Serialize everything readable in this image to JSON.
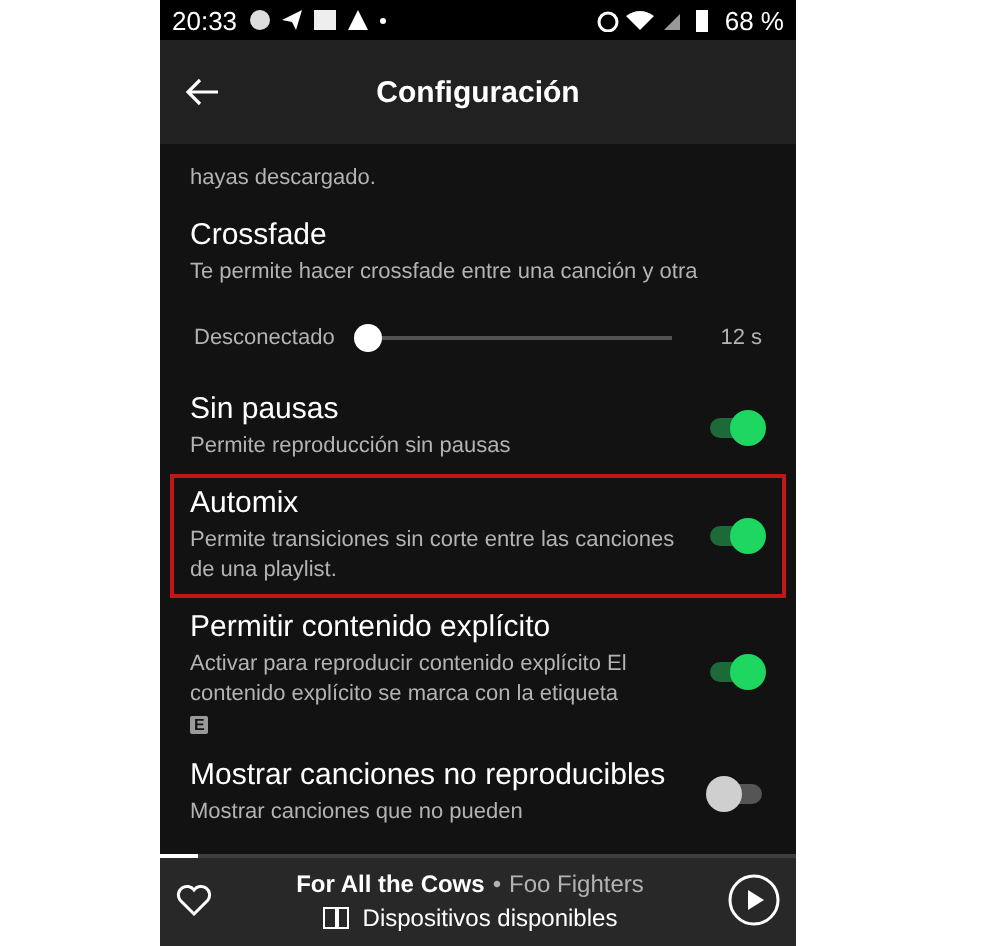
{
  "status_bar": {
    "time": "20:33",
    "battery": "68 %"
  },
  "header": {
    "title": "Configuración"
  },
  "settings": [
    {
      "kind": "text",
      "description": "hayas descargado."
    },
    {
      "kind": "text",
      "title": "Crossfade",
      "description": "Te permite hacer crossfade entre una canción y otra"
    },
    {
      "kind": "slider",
      "min_label": "Desconectado",
      "max_label": "12 s",
      "level": 0
    },
    {
      "kind": "toggle",
      "title": "Sin pausas",
      "description": "Permite reproducción sin pausas",
      "on": true,
      "highlighted": false
    },
    {
      "kind": "toggle",
      "title": "Automix",
      "description": "Permite transiciones sin corte entre las canciones de una playlist.",
      "on": true,
      "highlighted": true
    },
    {
      "kind": "toggle",
      "title": "Permitir contenido explícito",
      "description": "Activar para reproducir contenido explícito El contenido explícito se marca con la etiqueta",
      "badge": "E",
      "on": true,
      "highlighted": false
    },
    {
      "kind": "toggle",
      "title": "Mostrar canciones no reproducibles",
      "description": "Mostrar canciones que no pueden",
      "on": false,
      "highlighted": false
    }
  ],
  "player": {
    "track": "For All the Cows",
    "artist": "Foo Fighters",
    "separator": "•",
    "devices": "Dispositivos disponibles",
    "level": 0.06
  }
}
